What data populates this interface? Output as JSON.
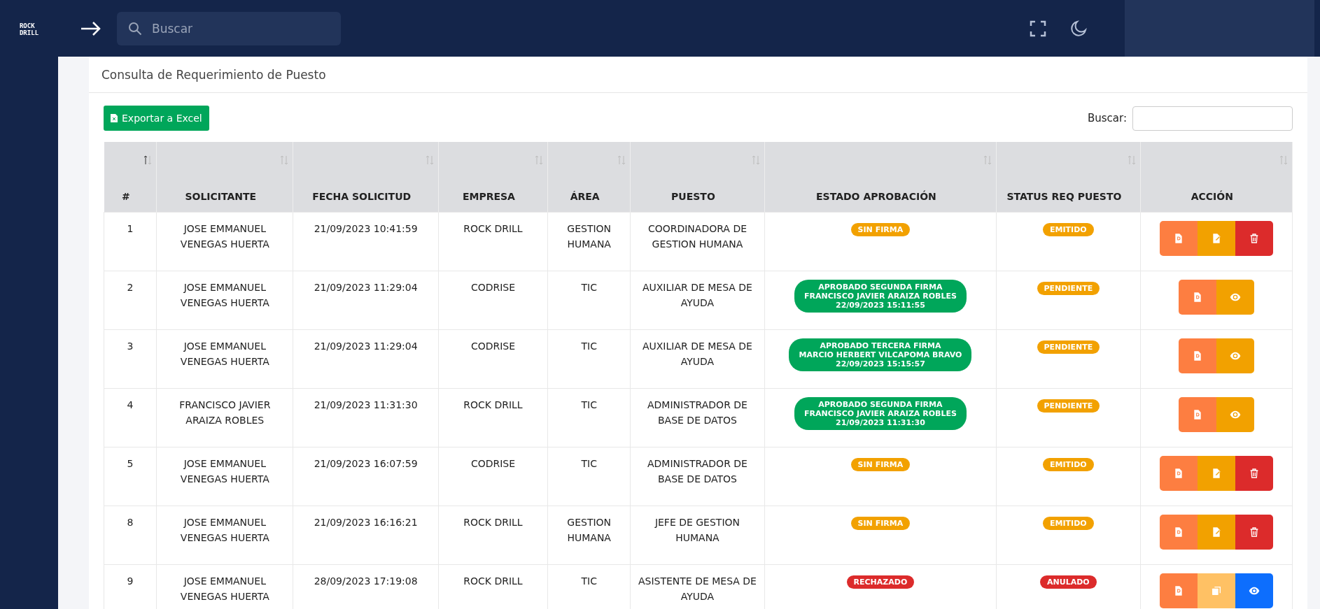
{
  "sidebar": {
    "logo": [
      "ROCK",
      "DRILL"
    ]
  },
  "topbar": {
    "search": {
      "placeholder": "Buscar"
    }
  },
  "card": {
    "title": "Consulta de Requerimiento de Puesto",
    "export_button": "Exportar a Excel",
    "search_label": "Buscar:"
  },
  "table": {
    "columns": [
      {
        "label": "#",
        "sorted": true
      },
      {
        "label": "SOLICITANTE",
        "sorted": false
      },
      {
        "label": "FECHA SOLICITUD",
        "sorted": false
      },
      {
        "label": "EMPRESA",
        "sorted": false
      },
      {
        "label": "ÁREA",
        "sorted": false
      },
      {
        "label": "PUESTO",
        "sorted": false
      },
      {
        "label": "ESTADO APROBACIÓN",
        "sorted": false
      },
      {
        "label": "STATUS REQ PUESTO",
        "sorted": false
      },
      {
        "label": "ACCIÓN",
        "sorted": false
      }
    ],
    "rows": [
      {
        "n": "1",
        "solicitante": "JOSE EMMANUEL VENEGAS HUERTA",
        "fecha": "21/09/2023 10:41:59",
        "empresa": "ROCK DRILL",
        "area": "GESTION HUMANA",
        "puesto": "COORDINADORA DE GESTION HUMANA",
        "estado": {
          "lines": [
            "SIN FIRMA"
          ],
          "color": "#f2a100"
        },
        "status": {
          "label": "EMITIDO",
          "color": "#f2a100"
        },
        "actions": [
          {
            "kind": "pdf",
            "color": "#fd7e41"
          },
          {
            "kind": "edit",
            "color": "#f2a100"
          },
          {
            "kind": "delete",
            "color": "#dc2b2b"
          }
        ]
      },
      {
        "n": "2",
        "solicitante": "JOSE EMMANUEL VENEGAS HUERTA",
        "fecha": "21/09/2023 11:29:04",
        "empresa": "CODRISE",
        "area": "TIC",
        "puesto": "AUXILIAR DE MESA DE AYUDA",
        "estado": {
          "lines": [
            "APROBADO SEGUNDA FIRMA",
            "FRANCISCO JAVIER ARAIZA ROBLES",
            "22/09/2023 15:11:55"
          ],
          "color": "#00a65a"
        },
        "status": {
          "label": "PENDIENTE",
          "color": "#f2a100"
        },
        "actions": [
          {
            "kind": "pdf",
            "color": "#fd7e41"
          },
          {
            "kind": "view",
            "color": "#f2a100"
          }
        ]
      },
      {
        "n": "3",
        "solicitante": "JOSE EMMANUEL VENEGAS HUERTA",
        "fecha": "21/09/2023 11:29:04",
        "empresa": "CODRISE",
        "area": "TIC",
        "puesto": "AUXILIAR DE MESA DE AYUDA",
        "estado": {
          "lines": [
            "APROBADO TERCERA FIRMA",
            "MARCIO HERBERT VILCAPOMA BRAVO",
            "22/09/2023 15:15:57"
          ],
          "color": "#00a65a"
        },
        "status": {
          "label": "PENDIENTE",
          "color": "#f2a100"
        },
        "actions": [
          {
            "kind": "pdf",
            "color": "#fd7e41"
          },
          {
            "kind": "view",
            "color": "#f2a100"
          }
        ]
      },
      {
        "n": "4",
        "solicitante": "FRANCISCO JAVIER ARAIZA ROBLES",
        "fecha": "21/09/2023 11:31:30",
        "empresa": "ROCK DRILL",
        "area": "TIC",
        "puesto": "ADMINISTRADOR DE BASE DE DATOS",
        "estado": {
          "lines": [
            "APROBADO SEGUNDA FIRMA",
            "FRANCISCO JAVIER ARAIZA ROBLES",
            "21/09/2023 11:31:30"
          ],
          "color": "#00a65a"
        },
        "status": {
          "label": "PENDIENTE",
          "color": "#f2a100"
        },
        "actions": [
          {
            "kind": "pdf",
            "color": "#fd7e41"
          },
          {
            "kind": "view",
            "color": "#f2a100"
          }
        ]
      },
      {
        "n": "5",
        "solicitante": "JOSE EMMANUEL VENEGAS HUERTA",
        "fecha": "21/09/2023 16:07:59",
        "empresa": "CODRISE",
        "area": "TIC",
        "puesto": "ADMINISTRADOR DE BASE DE DATOS",
        "estado": {
          "lines": [
            "SIN FIRMA"
          ],
          "color": "#f2a100"
        },
        "status": {
          "label": "EMITIDO",
          "color": "#f2a100"
        },
        "actions": [
          {
            "kind": "pdf",
            "color": "#fd7e41"
          },
          {
            "kind": "edit",
            "color": "#f2a100"
          },
          {
            "kind": "delete",
            "color": "#dc2b2b"
          }
        ]
      },
      {
        "n": "8",
        "solicitante": "JOSE EMMANUEL VENEGAS HUERTA",
        "fecha": "21/09/2023 16:16:21",
        "empresa": "ROCK DRILL",
        "area": "GESTION HUMANA",
        "puesto": "JEFE DE GESTION HUMANA",
        "estado": {
          "lines": [
            "SIN FIRMA"
          ],
          "color": "#f2a100"
        },
        "status": {
          "label": "EMITIDO",
          "color": "#f2a100"
        },
        "actions": [
          {
            "kind": "pdf",
            "color": "#fd7e41"
          },
          {
            "kind": "edit",
            "color": "#f2a100"
          },
          {
            "kind": "delete",
            "color": "#dc2b2b"
          }
        ]
      },
      {
        "n": "9",
        "solicitante": "JOSE EMMANUEL VENEGAS HUERTA",
        "fecha": "28/09/2023 17:19:08",
        "empresa": "ROCK DRILL",
        "area": "TIC",
        "puesto": "ASISTENTE DE MESA DE AYUDA",
        "estado": {
          "lines": [
            "RECHAZADO"
          ],
          "color": "#dc2b2b"
        },
        "status": {
          "label": "ANULADO",
          "color": "#dc2b2b"
        },
        "actions": [
          {
            "kind": "pdf",
            "color": "#fd7e41"
          },
          {
            "kind": "copy",
            "color": "#ffc164"
          },
          {
            "kind": "view",
            "color": "#0d6efd"
          }
        ]
      }
    ]
  }
}
